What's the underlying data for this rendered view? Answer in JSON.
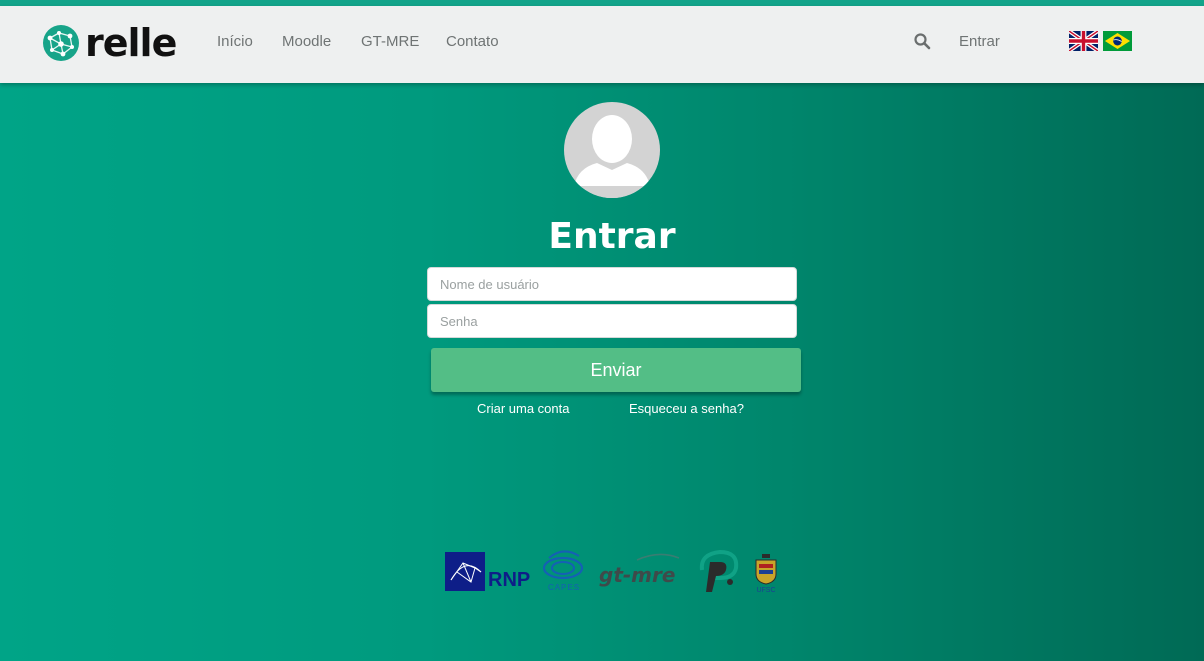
{
  "brand": {
    "name": "relle",
    "accent_color": "#12a48a",
    "icon": "relle-network-logo-icon"
  },
  "nav": {
    "items": [
      {
        "label": "Início"
      },
      {
        "label": "Moodle"
      },
      {
        "label": "GT-MRE"
      },
      {
        "label": "Contato"
      }
    ],
    "search_icon": "search-icon",
    "login_label": "Entrar",
    "languages": [
      {
        "name": "English",
        "icon": "uk-flag-icon"
      },
      {
        "name": "Português",
        "icon": "brazil-flag-icon"
      }
    ]
  },
  "login": {
    "avatar_icon": "user-avatar-icon",
    "title": "Entrar",
    "username_placeholder": "Nome de usuário",
    "username_value": "",
    "password_placeholder": "Senha",
    "password_value": "",
    "submit_label": "Enviar",
    "submit_color": "#53be86",
    "create_account_label": "Criar uma conta",
    "forgot_password_label": "Esqueceu a senha?"
  },
  "partners": {
    "rnp_text": "RNP",
    "capes_text": "CAPES",
    "gtmre_text": "gt-mre",
    "ufsc_text": "UFSC"
  }
}
